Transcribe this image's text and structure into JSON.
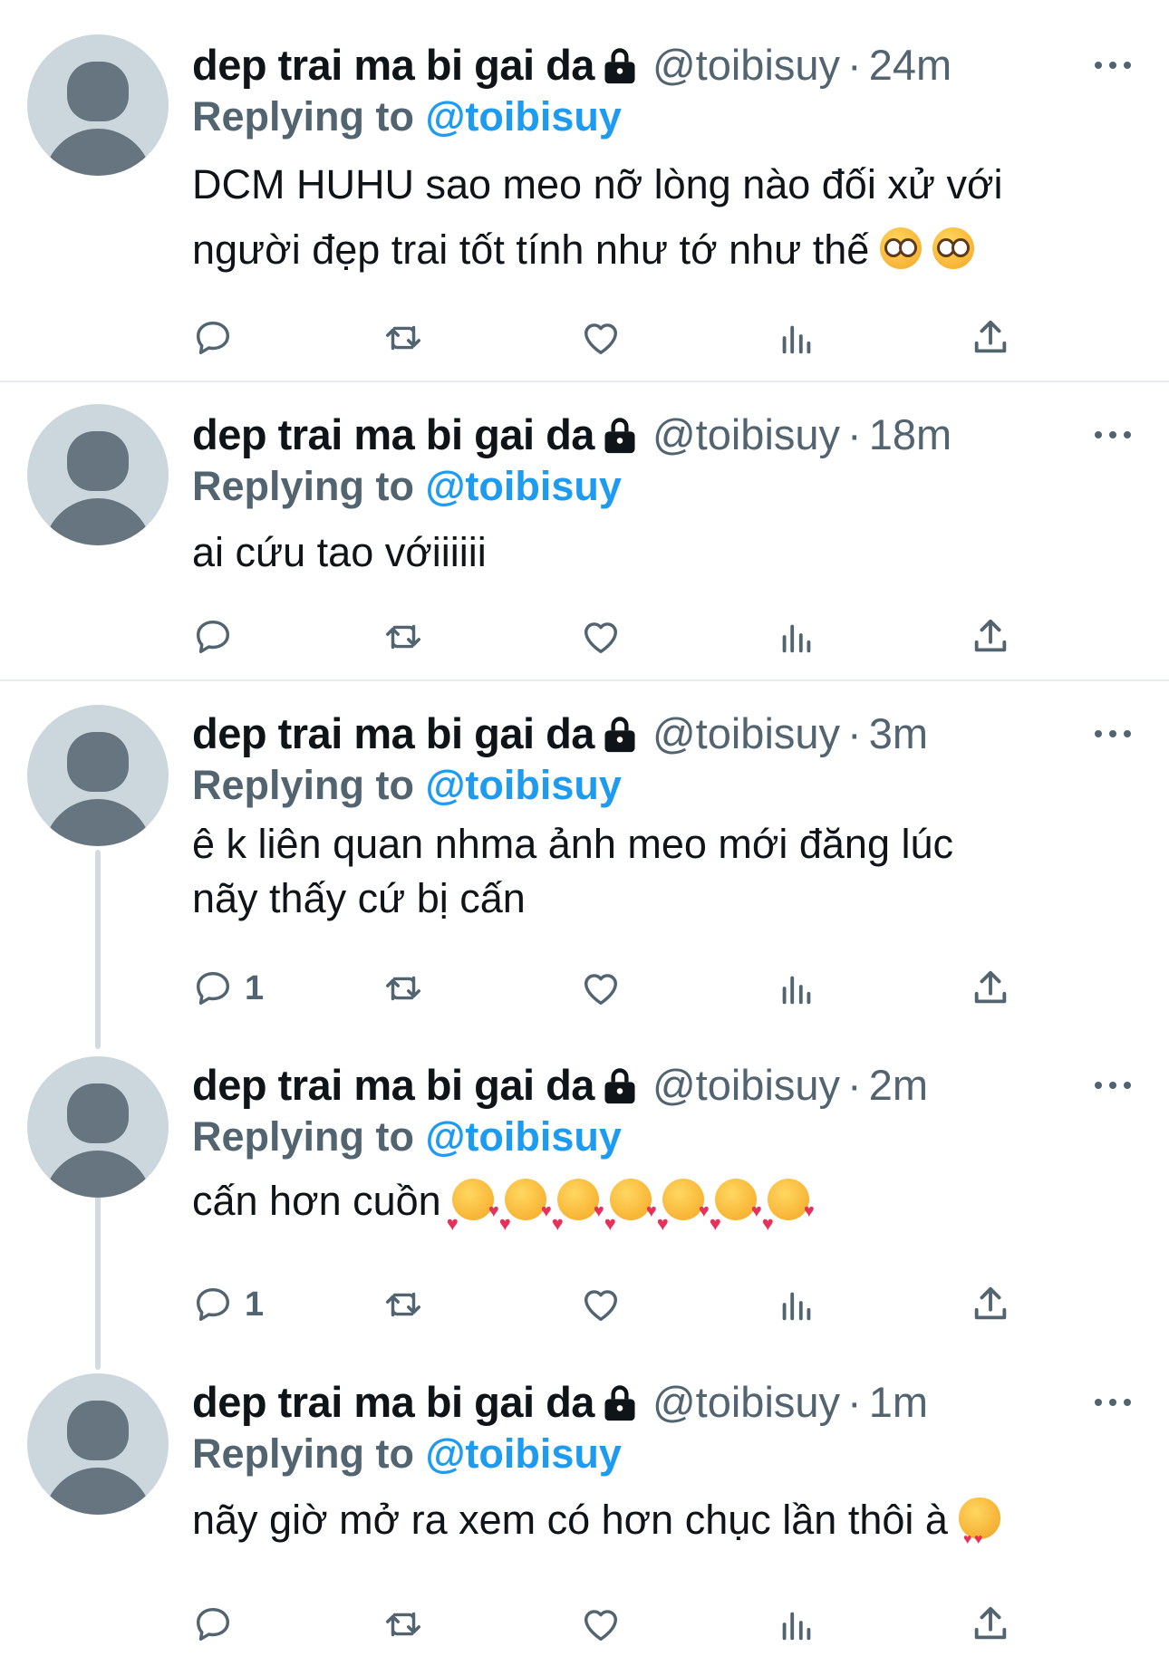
{
  "tweets": [
    {
      "name": "dep trai ma bi gai da",
      "handle": "@toibisuy",
      "separator": "·",
      "time": "24m",
      "replying_prefix": "Replying to",
      "replying_to": "@toibisuy",
      "text_lines": [
        "DCM HUHU sao meo nỡ lòng nào đối xử với",
        "người đẹp trai tốt tính như tớ như thế"
      ],
      "emojis": [
        "pleading-face",
        "pleading-face"
      ],
      "reply_count": ""
    },
    {
      "name": "dep trai ma bi gai da",
      "handle": "@toibisuy",
      "separator": "·",
      "time": "18m",
      "replying_prefix": "Replying to",
      "replying_to": "@toibisuy",
      "text_lines": [
        "ai cứu tao vớiiiiii"
      ],
      "emojis": [],
      "reply_count": ""
    },
    {
      "name": "dep trai ma bi gai da",
      "handle": "@toibisuy",
      "separator": "·",
      "time": "3m",
      "replying_prefix": "Replying to",
      "replying_to": "@toibisuy",
      "text_lines": [
        "ê k liên quan nhma ảnh meo mới đăng lúc",
        "nãy thấy cứ bị cấn"
      ],
      "emojis": [],
      "reply_count": "1"
    },
    {
      "name": "dep trai ma bi gai da",
      "handle": "@toibisuy",
      "separator": "·",
      "time": "2m",
      "replying_prefix": "Replying to",
      "replying_to": "@toibisuy",
      "text_lines": [
        "cấn hơn cuồn"
      ],
      "emojis": [
        "smiling-face-with-hearts",
        "smiling-face-with-hearts",
        "smiling-face-with-hearts",
        "smiling-face-with-hearts",
        "smiling-face-with-hearts",
        "smiling-face-with-hearts",
        "smiling-face-with-hearts"
      ],
      "reply_count": "1"
    },
    {
      "name": "dep trai ma bi gai da",
      "handle": "@toibisuy",
      "separator": "·",
      "time": "1m",
      "replying_prefix": "Replying to",
      "replying_to": "@toibisuy",
      "text_lines": [
        "nãy giờ mở ra xem có hơn chục lần thôi à"
      ],
      "emojis": [
        "smiling-cat-heart-eyes"
      ],
      "reply_count": ""
    }
  ],
  "icons": {
    "lock": "lock-icon",
    "more": "more-icon",
    "reply": "reply-icon",
    "retweet": "retweet-icon",
    "like": "like-icon",
    "views": "views-icon",
    "share": "share-icon"
  },
  "colors": {
    "link": "#1d9bf0",
    "secondary_text": "#536471",
    "avatar_bg": "#ccd6dd",
    "divider": "#e6ecf0"
  }
}
